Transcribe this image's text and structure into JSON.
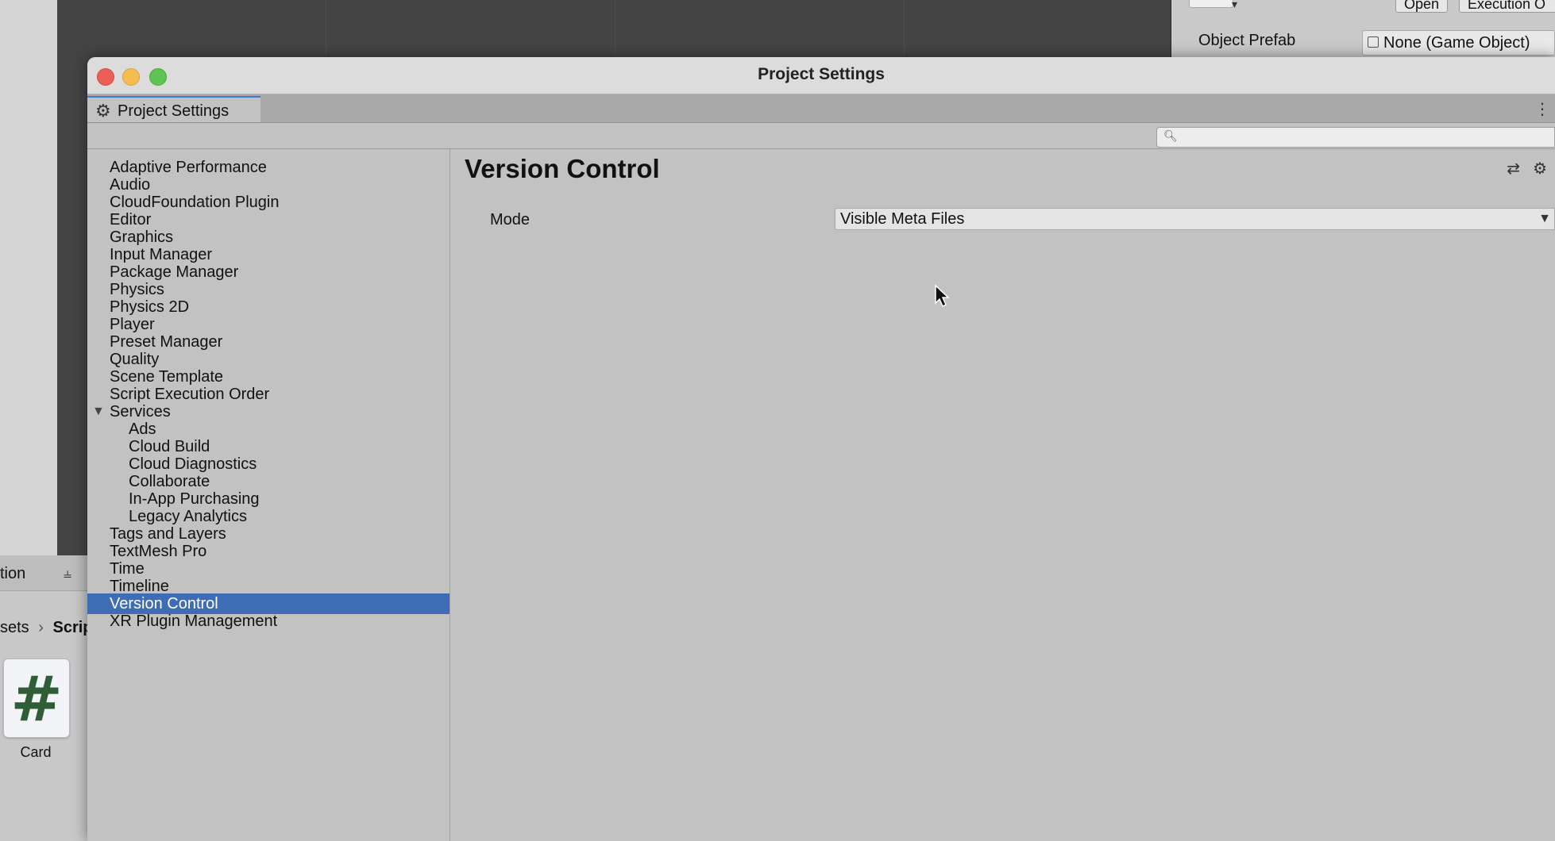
{
  "background": {
    "inspector": {
      "buttons": [
        "Open",
        "Execution O"
      ],
      "object_prefab_label": "Object Prefab",
      "object_prefab_value": "None (Game Object)"
    },
    "project": {
      "tab_label": "tion",
      "breadcrumb_parent": "sets",
      "breadcrumb_current": "Scrip",
      "file_icon": "#",
      "file_name": "Card"
    }
  },
  "window": {
    "title": "Project Settings",
    "tab_label": "Project Settings",
    "search_placeholder": ""
  },
  "sidebar": {
    "items": [
      {
        "label": "Adaptive Performance"
      },
      {
        "label": "Audio"
      },
      {
        "label": "CloudFoundation Plugin"
      },
      {
        "label": "Editor"
      },
      {
        "label": "Graphics"
      },
      {
        "label": "Input Manager"
      },
      {
        "label": "Package Manager"
      },
      {
        "label": "Physics"
      },
      {
        "label": "Physics 2D"
      },
      {
        "label": "Player"
      },
      {
        "label": "Preset Manager"
      },
      {
        "label": "Quality"
      },
      {
        "label": "Scene Template"
      },
      {
        "label": "Script Execution Order"
      },
      {
        "label": "Services",
        "expanded": true
      },
      {
        "label": "Ads",
        "child": true
      },
      {
        "label": "Cloud Build",
        "child": true
      },
      {
        "label": "Cloud Diagnostics",
        "child": true
      },
      {
        "label": "Collaborate",
        "child": true
      },
      {
        "label": "In-App Purchasing",
        "child": true
      },
      {
        "label": "Legacy Analytics",
        "child": true
      },
      {
        "label": "Tags and Layers"
      },
      {
        "label": "TextMesh Pro"
      },
      {
        "label": "Time"
      },
      {
        "label": "Timeline"
      },
      {
        "label": "Version Control",
        "selected": true
      },
      {
        "label": "XR Plugin Management"
      }
    ]
  },
  "content": {
    "title": "Version Control",
    "mode_label": "Mode",
    "mode_value": "Visible Meta Files"
  },
  "colors": {
    "selection": "#3e6db5",
    "panel": "#c2c2c2",
    "close": "#ec5f58",
    "minimize": "#f4be4f",
    "maximize": "#5fc454"
  }
}
